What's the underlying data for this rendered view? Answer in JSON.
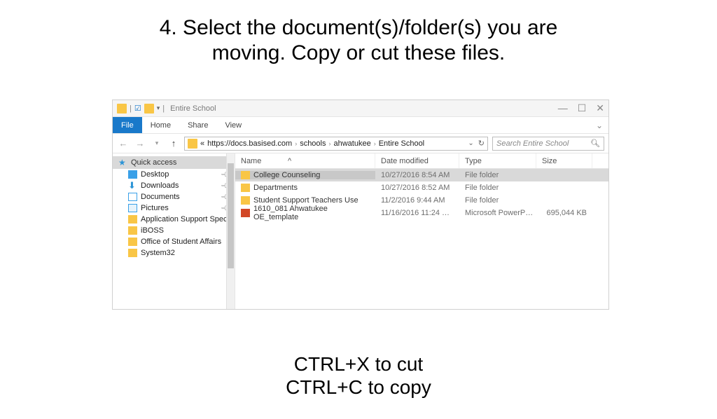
{
  "title_line1": "4. Select the document(s)/folder(s) you are",
  "title_line2": "moving. Copy or cut these files.",
  "titlebar": {
    "window_title": "Entire School"
  },
  "ribbon": {
    "file": "File",
    "home": "Home",
    "share": "Share",
    "view": "View"
  },
  "address": {
    "prefix": "«",
    "root": "https://docs.basised.com",
    "crumb1": "schools",
    "crumb2": "ahwatukee",
    "crumb3": "Entire School"
  },
  "search": {
    "placeholder": "Search Entire School"
  },
  "sidebar": {
    "quick_access": "Quick access",
    "items": [
      {
        "label": "Desktop",
        "icon": "desk",
        "pin": true
      },
      {
        "label": "Downloads",
        "icon": "dl",
        "pin": true
      },
      {
        "label": "Documents",
        "icon": "doc",
        "pin": true
      },
      {
        "label": "Pictures",
        "icon": "pic",
        "pin": true
      },
      {
        "label": "Application Support Specialist",
        "icon": "fold",
        "pin": false
      },
      {
        "label": "iBOSS",
        "icon": "fold",
        "pin": false
      },
      {
        "label": "Office of Student Affairs",
        "icon": "fold",
        "pin": false
      },
      {
        "label": "System32",
        "icon": "fold",
        "pin": false
      }
    ]
  },
  "columns": {
    "name": "Name",
    "date": "Date modified",
    "type": "Type",
    "size": "Size"
  },
  "rows": [
    {
      "name": "College Counseling",
      "date": "10/27/2016 8:54 AM",
      "type": "File folder",
      "size": "",
      "icon": "fold",
      "selected": true
    },
    {
      "name": "Departments",
      "date": "10/27/2016 8:52 AM",
      "type": "File folder",
      "size": "",
      "icon": "fold",
      "selected": false
    },
    {
      "name": "Student Support Teachers Use",
      "date": "11/2/2016 9:44 AM",
      "type": "File folder",
      "size": "",
      "icon": "fold",
      "selected": false
    },
    {
      "name": "1610_081 Ahwatukee OE_template",
      "date": "11/16/2016 11:24 …",
      "type": "Microsoft PowerP…",
      "size": "695,044 KB",
      "icon": "pp",
      "selected": false
    }
  ],
  "tips": {
    "cut": "CTRL+X to cut",
    "copy": "CTRL+C to copy"
  }
}
